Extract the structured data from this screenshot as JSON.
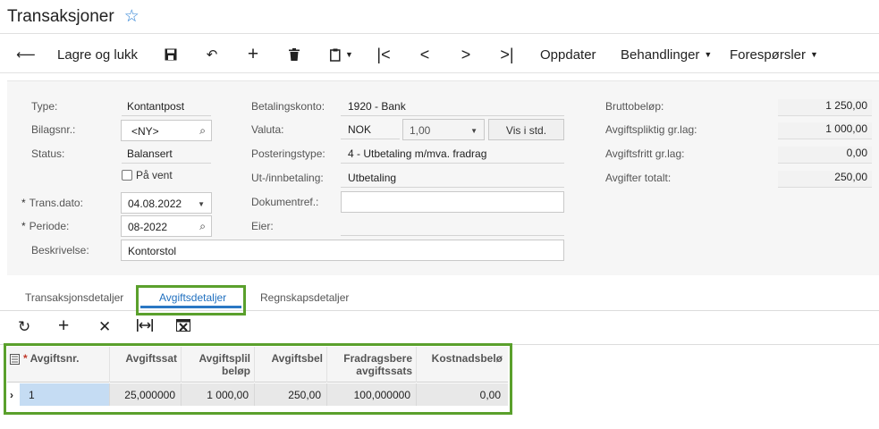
{
  "header": {
    "title": "Transaksjoner"
  },
  "toolbar": {
    "save_close": "Lagre og lukk",
    "refresh": "Oppdater",
    "actions": "Behandlinger",
    "inquiries": "Forespørsler"
  },
  "form": {
    "type_label": "Type:",
    "type_value": "Kontantpost",
    "ref_label": "Bilagsnr.:",
    "ref_value": "<NY>",
    "status_label": "Status:",
    "status_value": "Balansert",
    "hold_label": "På vent",
    "date_label": "Trans.dato:",
    "date_value": "04.08.2022",
    "period_label": "Periode:",
    "period_value": "08-2022",
    "desc_label": "Beskrivelse:",
    "desc_value": "Kontorstol",
    "account_label": "Betalingskonto:",
    "account_value": "1920 - Bank",
    "currency_label": "Valuta:",
    "currency_value": "NOK",
    "rate_value": "1,00",
    "view_base_button": "Vis i std.",
    "entry_type_label": "Posteringstype:",
    "entry_type_value": "4 - Utbetaling m/mva. fradrag",
    "disb_label": "Ut-/innbetaling:",
    "disb_value": "Utbetaling",
    "docref_label": "Dokumentref.:",
    "docref_value": "",
    "owner_label": "Eier:",
    "owner_value": ""
  },
  "summary": [
    {
      "label": "Bruttobeløp:",
      "value": "1 250,00"
    },
    {
      "label": "Avgiftspliktig gr.lag:",
      "value": "1 000,00"
    },
    {
      "label": "Avgiftsfritt gr.lag:",
      "value": "0,00"
    },
    {
      "label": "Avgifter totalt:",
      "value": "250,00"
    }
  ],
  "tabs": [
    "Transaksjonsdetaljer",
    "Avgiftsdetaljer",
    "Regnskapsdetaljer"
  ],
  "grid": {
    "columns": [
      "Avgiftsnr.",
      "Avgiftssat",
      "Avgiftsplil beløp",
      "Avgiftsbel",
      "Fradragsbere avgiftssats",
      "Kostnadsbelø"
    ],
    "col_line1": [
      "Avgiftsnr.",
      "Avgiftssat",
      "Avgiftsplil",
      "Avgiftsbel",
      "Fradragsbere",
      "Kostnadsbelø"
    ],
    "col_line2": [
      "",
      "",
      "beløp",
      "",
      "avgiftssats",
      ""
    ],
    "rows": [
      [
        "1",
        "25,000000",
        "1 000,00",
        "250,00",
        "100,000000",
        "0,00"
      ]
    ]
  },
  "colors": {
    "accent": "#2b78c4",
    "highlight": "#5aa02c",
    "selected_cell": "#c5dcf3"
  }
}
